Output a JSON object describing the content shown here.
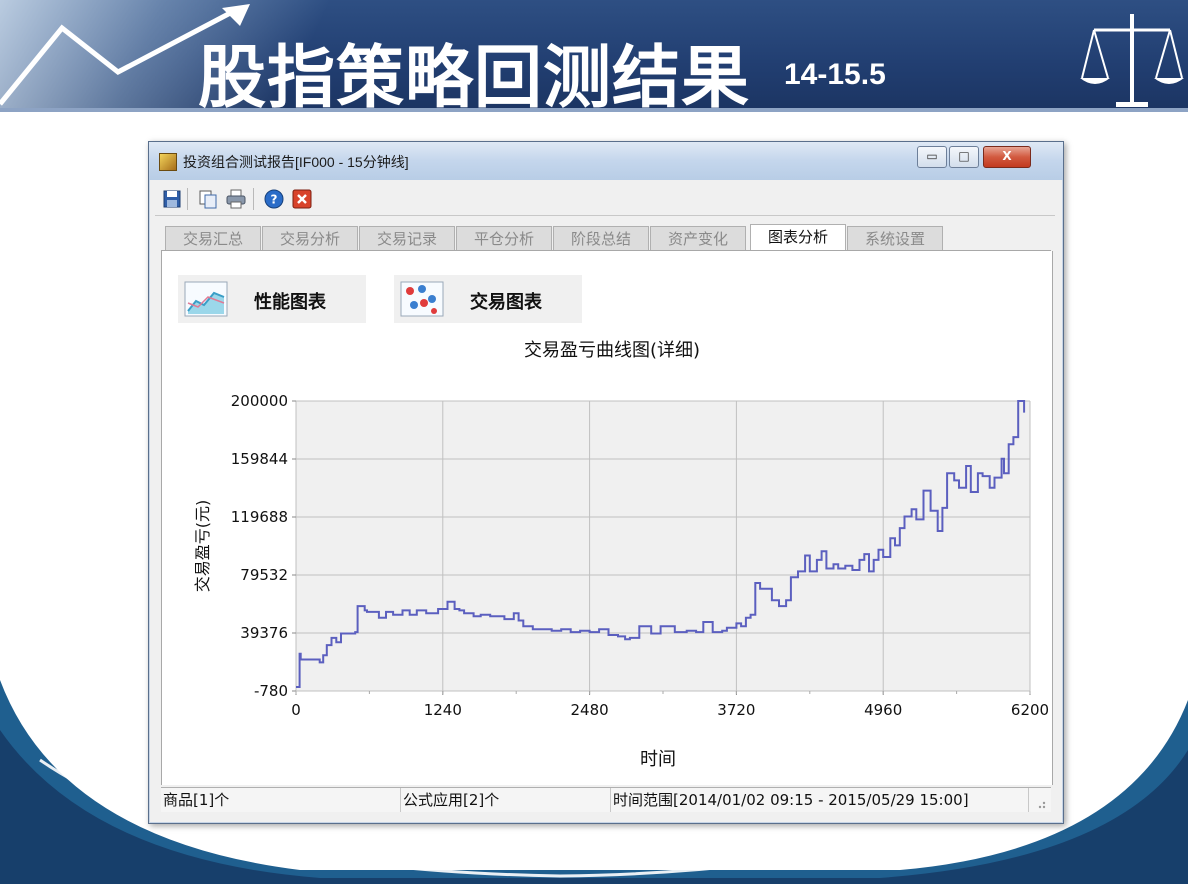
{
  "slide": {
    "title": "股指策略回测结果",
    "title_suffix": "14-15.5"
  },
  "window": {
    "title": "投资组合测试报告[IF000 - 15分钟线]",
    "controls": {
      "minimize": "▭",
      "maximize": "□",
      "close": "X"
    }
  },
  "toolbar": {
    "buttons": [
      "save-icon",
      "copy-icon",
      "print-icon",
      "help-icon",
      "close-report-icon"
    ]
  },
  "tabs": [
    {
      "label": "交易汇总",
      "active": false
    },
    {
      "label": "交易分析",
      "active": false
    },
    {
      "label": "交易记录",
      "active": false
    },
    {
      "label": "平仓分析",
      "active": false
    },
    {
      "label": "阶段总结",
      "active": false
    },
    {
      "label": "资产变化",
      "active": false
    },
    {
      "label": "图表分析",
      "active": true
    },
    {
      "label": "系统设置",
      "active": false
    }
  ],
  "subtabs": {
    "performance": "性能图表",
    "trades": "交易图表"
  },
  "statusbar": {
    "symbols": "商品[1]个",
    "formulas": "公式应用[2]个",
    "range": "时间范围[2014/01/02 09:15 - 2015/05/29 15:00]"
  },
  "colors": {
    "series": "#5b5fbf",
    "plot_bg": "#f0f0f0",
    "grid": "#c0c0c0"
  },
  "chart_data": {
    "type": "line",
    "title": "交易盈亏曲线图(详细)",
    "xlabel": "时间",
    "ylabel": "交易盈亏(元)",
    "xlim": [
      0,
      6200
    ],
    "ylim": [
      -780,
      200000
    ],
    "xticks": [
      "0",
      "1240",
      "2480",
      "3720",
      "4960",
      "6200"
    ],
    "yticks": [
      "200000",
      "159844",
      "119688",
      "79532",
      "39376",
      "-780"
    ],
    "grid": true,
    "series": [
      {
        "x": [
          0,
          30,
          40,
          200,
          230,
          260,
          300,
          340,
          380,
          420,
          460,
          500,
          520,
          580,
          600,
          700,
          760,
          820,
          900,
          960,
          1020,
          1100,
          1200,
          1280,
          1340,
          1380,
          1420,
          1500,
          1560,
          1640,
          1760,
          1840,
          1880,
          1920,
          2000,
          2080,
          2160,
          2240,
          2320,
          2400,
          2480,
          2560,
          2640,
          2720,
          2780,
          2820,
          2900,
          3000,
          3080,
          3200,
          3300,
          3380,
          3440,
          3520,
          3600,
          3640,
          3720,
          3760,
          3800,
          3840,
          3880,
          3920,
          4000,
          4020,
          4080,
          4140,
          4180,
          4240,
          4300,
          4340,
          4400,
          4440,
          4480,
          4540,
          4580,
          4640,
          4700,
          4760,
          4800,
          4840,
          4880,
          4920,
          4960,
          5020,
          5060,
          5100,
          5140,
          5200,
          5240,
          5300,
          5360,
          5420,
          5460,
          5500,
          5560,
          5600,
          5660,
          5700,
          5760,
          5800,
          5860,
          5900,
          5960,
          5980,
          6020,
          6060,
          6100,
          6150
        ],
        "y": [
          2000,
          25000,
          21000,
          19000,
          24000,
          31000,
          36000,
          33000,
          39000,
          39000,
          39000,
          40000,
          58000,
          55000,
          54000,
          50000,
          54000,
          52000,
          55000,
          52000,
          55000,
          53000,
          56000,
          61000,
          56000,
          55000,
          53000,
          51000,
          52000,
          51000,
          49000,
          53000,
          48000,
          44000,
          42000,
          42000,
          41000,
          42000,
          40000,
          41000,
          40000,
          42000,
          38000,
          37000,
          35000,
          36000,
          44000,
          39000,
          44000,
          40000,
          41000,
          40000,
          47000,
          40000,
          41000,
          43000,
          46000,
          44000,
          50000,
          52000,
          74000,
          70000,
          70000,
          62000,
          58000,
          62000,
          78000,
          82000,
          93000,
          82000,
          90000,
          96000,
          84000,
          87000,
          84000,
          86000,
          83000,
          90000,
          94000,
          82000,
          90000,
          97000,
          92000,
          105000,
          100000,
          112000,
          120000,
          125000,
          118000,
          138000,
          124000,
          110000,
          126000,
          150000,
          145000,
          140000,
          155000,
          137000,
          150000,
          148000,
          140000,
          147000,
          160000,
          150000,
          170000,
          175000,
          200000,
          192000
        ]
      }
    ]
  }
}
